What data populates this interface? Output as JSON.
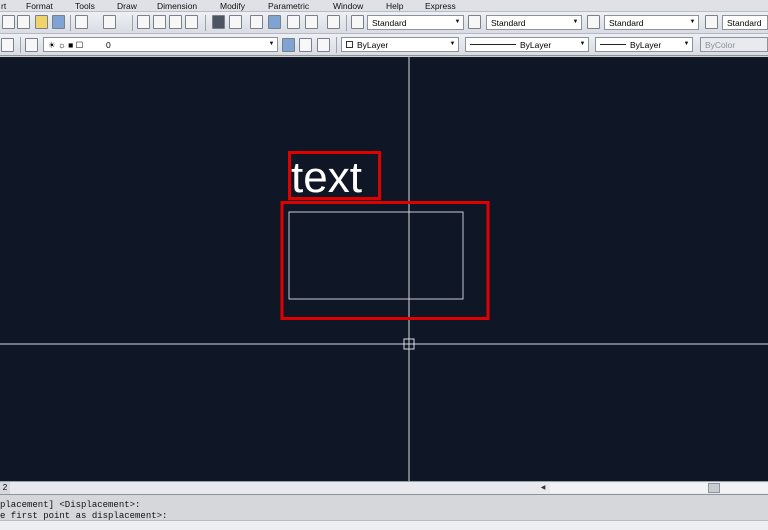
{
  "menu": {
    "items": [
      "rt",
      "Format",
      "Tools",
      "Draw",
      "Dimension",
      "Modify",
      "Parametric",
      "Window",
      "Help",
      "Express"
    ]
  },
  "toolbar": {
    "text_style": "Standard",
    "dim_style": "Standard",
    "table_style": "Standard",
    "multileader_style": "Standard",
    "layer": "0",
    "color": "ByLayer",
    "linetype": "ByLayer",
    "lineweight": "ByLayer",
    "plot_style": "ByColor"
  },
  "drawing": {
    "text_entity": "text",
    "background_color": "#0f1626",
    "highlight_color": "#e00000",
    "entity_color": "#c9cbd2",
    "crosshair_color": "#d7d9de"
  },
  "status": {
    "scroll_number": "2"
  },
  "command": {
    "history_1": "placement] <Displacement>:",
    "history_2": "e first point as displacement>:",
    "input": ""
  }
}
